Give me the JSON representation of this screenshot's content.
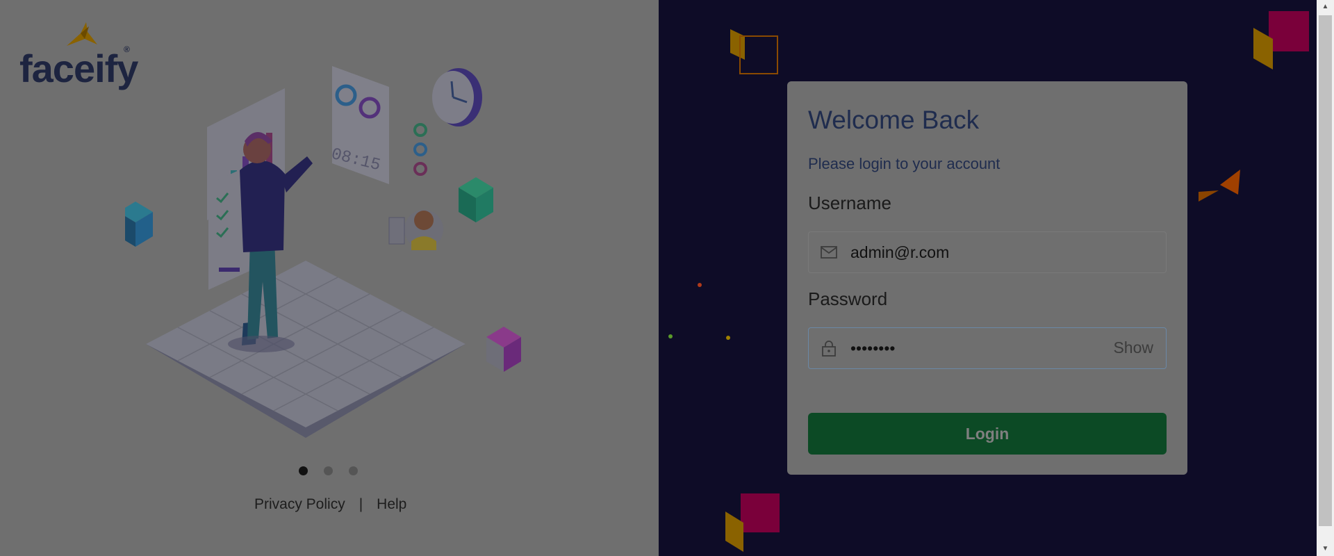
{
  "brand": {
    "name": "faceify",
    "registered": "®"
  },
  "carousel": {
    "slides": 3,
    "active_index": 0
  },
  "footer": {
    "privacy_label": "Privacy Policy",
    "separator": "|",
    "help_label": "Help"
  },
  "login": {
    "title": "Welcome Back",
    "subtitle": "Please login to your account",
    "username_label": "Username",
    "username_value": "admin@r.com",
    "password_label": "Password",
    "password_value": "••••••••",
    "show_label": "Show",
    "submit_label": "Login"
  },
  "icons": {
    "username": "envelope-icon",
    "password": "lock-icon"
  },
  "colors": {
    "right_bg": "#0e0c27",
    "login_button": "#0c4a25",
    "accent_magenta": "#a0003c",
    "accent_orange": "#b04a00",
    "accent_gold": "#a27300"
  },
  "illustration_text": {
    "clock_display": "08:15"
  }
}
